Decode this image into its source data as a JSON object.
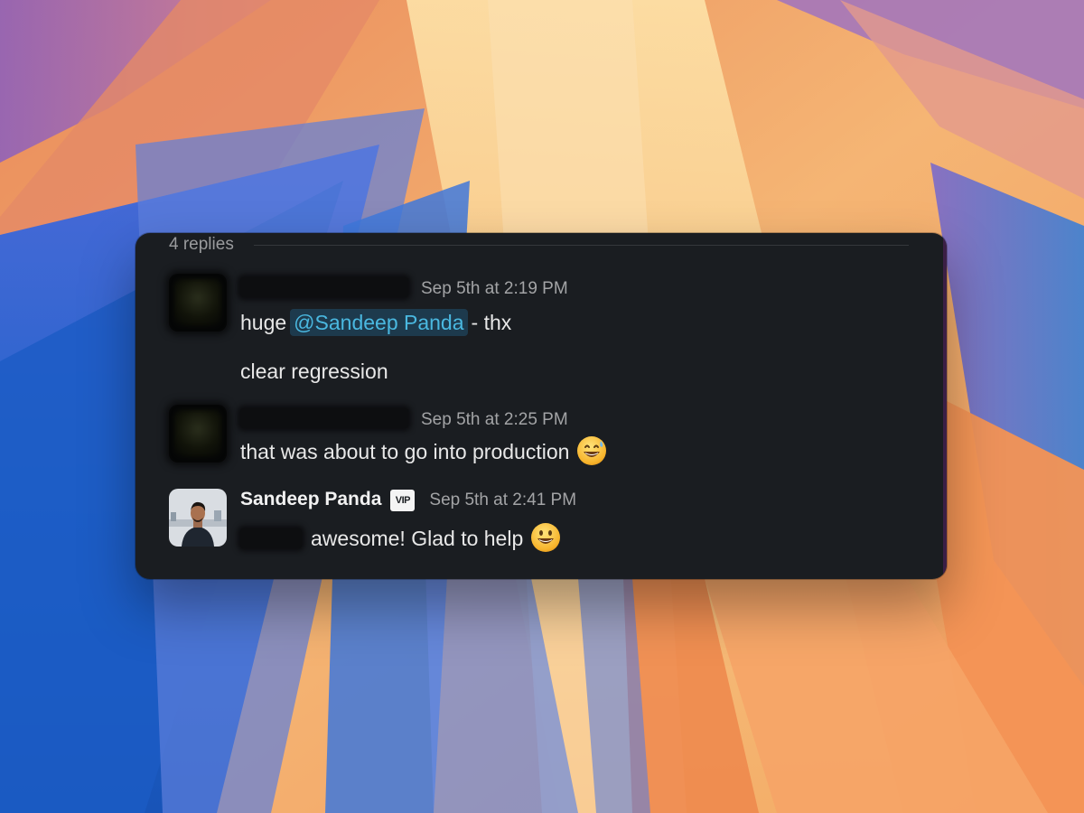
{
  "thread": {
    "replies_label": "4 replies",
    "messages": [
      {
        "timestamp": "Sep 5th at 2:19 PM",
        "line_1_prefix": "huge",
        "line_1_mention": "@Sandeep Panda",
        "line_1_suffix": "- thx",
        "line_2": "clear regression"
      },
      {
        "timestamp": "Sep 5th at 2:25 PM",
        "text": "that was about to go into production",
        "emoji": "grinning-face-with-sweat"
      },
      {
        "sender": "Sandeep Panda",
        "badge": "VIP",
        "timestamp": "Sep 5th at 2:41 PM",
        "text": "awesome! Glad to help",
        "emoji": "grinning-face"
      }
    ]
  },
  "colors": {
    "panel_background": "#1a1d21",
    "mention_text": "#4ab8e0",
    "mention_background": "#1d3a4d",
    "timestamp_text": "#a3a4a6"
  }
}
